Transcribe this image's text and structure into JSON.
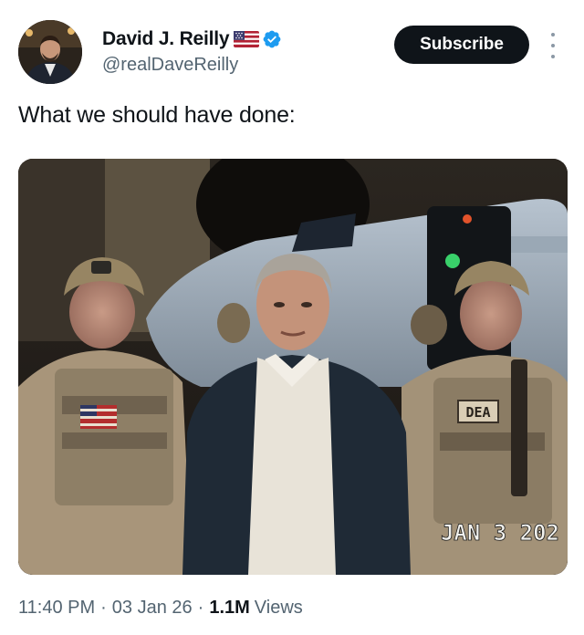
{
  "author": {
    "name": "David J. Reilly",
    "handle": "@realDaveReilly",
    "flag_icon": "us-flag-icon",
    "verified_icon": "verified-badge-icon",
    "verified_color": "#1d9bf0"
  },
  "actions": {
    "subscribe_label": "Subscribe",
    "more_icon": "more-options-icon"
  },
  "tweet": {
    "text": "What we should have done:"
  },
  "media": {
    "patch_text": "DEA",
    "date_stamp": "JAN  3 202"
  },
  "meta": {
    "time": "11:40 PM",
    "separator": "·",
    "date": "03 Jan 26",
    "views_count": "1.1M",
    "views_label": "Views"
  },
  "colors": {
    "text_primary": "#0f1419",
    "text_secondary": "#536471",
    "button_bg": "#0f1419"
  }
}
